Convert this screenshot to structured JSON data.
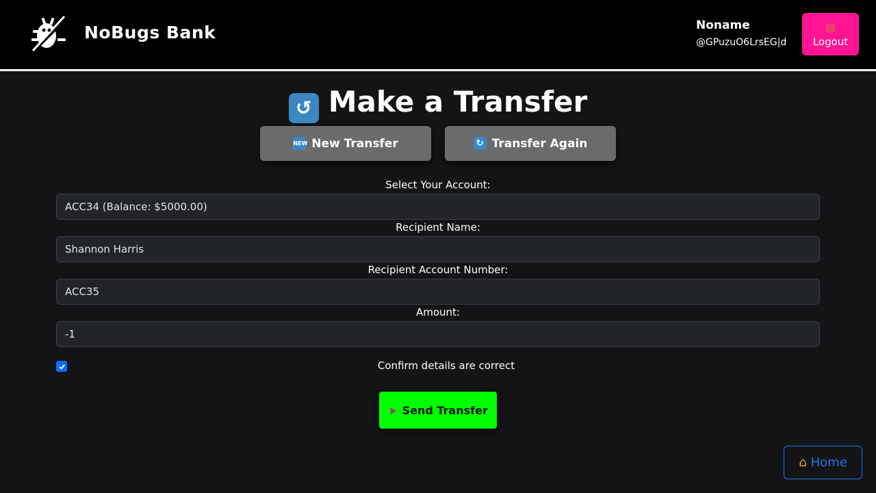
{
  "header": {
    "brand": "NoBugs Bank",
    "user_name": "Noname",
    "user_handle": "@GPuzuO6LrsEG|d",
    "logout_icon": "door-icon",
    "logout_label": "Logout"
  },
  "page": {
    "title_icon": "counterclockwise-arrows-icon",
    "title": "Make a Transfer"
  },
  "tabs": {
    "new_icon": "NEW",
    "new_label": "New Transfer",
    "again_icon": "repeat-icon",
    "again_label": "Transfer Again"
  },
  "form": {
    "account_label": "Select Your Account:",
    "account_value": "ACC34 (Balance: $5000.00)",
    "recipient_name_label": "Recipient Name:",
    "recipient_name_value": "Shannon Harris",
    "recipient_account_label": "Recipient Account Number:",
    "recipient_account_value": "ACC35",
    "amount_label": "Amount:",
    "amount_value": "-1",
    "confirm_checked": true,
    "confirm_label": "Confirm details are correct",
    "send_icon": "rocket-icon",
    "send_label": "Send Transfer"
  },
  "footer": {
    "home_icon": "house-icon",
    "home_label": "Home"
  },
  "colors": {
    "header_bg": "#000000",
    "page_bg": "#141416",
    "logout_bg": "#ff1493",
    "tab_bg": "#6b6b6b",
    "field_bg": "#212429",
    "checkbox": "#0d6efd",
    "send_bg": "#00ff00",
    "home_border": "#1e73e8"
  }
}
